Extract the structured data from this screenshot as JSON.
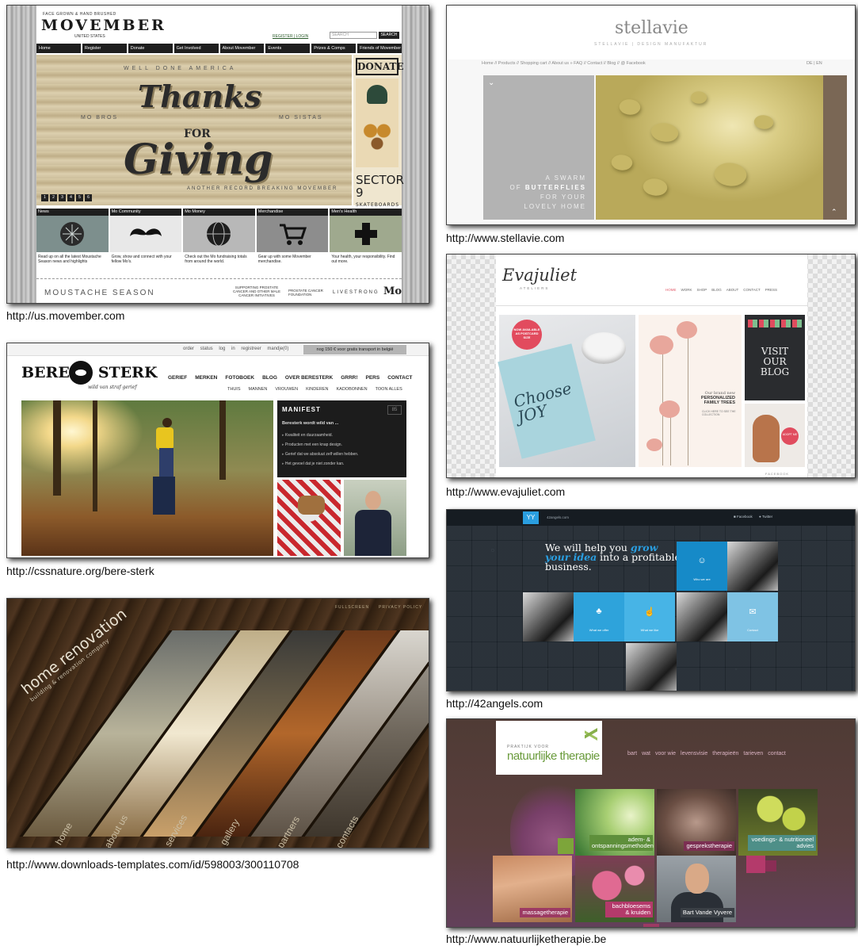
{
  "captions": {
    "movember": "http://us.movember.com",
    "beresterk": "http://cssnature.org/bere-sterk",
    "renovation": "http://www.downloads-templates.com/id/598003/300110708",
    "stellavie": "http://www.stellavie.com",
    "evajuliet": "http://www.evajuliet.com",
    "angels": "http://42angels.com",
    "therapie": "http://www.natuurlijketherapie.be"
  },
  "movember": {
    "tagline": "FACE GROWN & HAND BRUSHED",
    "logo": "MOVEMBER",
    "country": "UNITED STATES",
    "register_login": "REGISTER | LOGIN",
    "search_placeholder": "SEARCH",
    "search_button": "SEARCH",
    "nav": [
      "Home",
      "Register",
      "Donate",
      "Get Involved",
      "About Movember",
      "Events",
      "Prizes & Comps",
      "Friends of Movember"
    ],
    "hero": {
      "well_done": "WELL DONE AMERICA",
      "mo_bros": "MO BROS",
      "mo_sistas": "MO SISTAS",
      "thanks": "Thanks",
      "for": "FOR",
      "giving": "Giving",
      "another": "ANOTHER RECORD BREAKING MOVEMBER",
      "slides": [
        "1",
        "2",
        "3",
        "4",
        "5",
        "6"
      ]
    },
    "donate": "DONATE",
    "sector": "SECTOR 9",
    "sector_sub": "SKATEBOARDS",
    "tiles": [
      {
        "title": "News",
        "text": "Read up on all the latest Moustache Season news and highlights"
      },
      {
        "title": "Mo Community",
        "text": "Grow, show and connect with your fellow Mo's."
      },
      {
        "title": "Mo Money",
        "text": "Check out the Mo fundraising totals from around the world."
      },
      {
        "title": "Merchandise",
        "text": "Gear up with some Movember merchandise."
      },
      {
        "title": "Men's Health",
        "text": "Your health, your responsibility. Find out more."
      }
    ],
    "footer": {
      "season": "MOUSTACHE SEASON",
      "supporting": "SUPPORTING PROSTATE CANCER AND OTHER MALE CANCER INITIATIVES",
      "pcf": "PROSTATE CANCER FOUNDATION",
      "livestrong": "LIVESTRONG",
      "mo": "Mo"
    }
  },
  "beresterk": {
    "top_links": "order status   log in   registreer   mandje(0)",
    "promo": "nog 150 € voor gratis transport in belgië",
    "logo_left": "BERE",
    "logo_right": "STERK",
    "slogan": "wild van straf gerief",
    "menu": [
      "GERIEF",
      "MERKEN",
      "FOTOBOEK",
      "BLOG",
      "OVER BERESTERK",
      "GRRR!",
      "PERS",
      "CONTACT"
    ],
    "submenu": [
      "THUIS",
      "MANNEN",
      "VROUWEN",
      "KINDEREN",
      "KADOBONNEN",
      "TOON ALLES"
    ],
    "manifest": {
      "title": "MANIFEST",
      "number": "85",
      "intro": "Beresterk wordt wild van ...",
      "items": [
        "Kwaliteit en duurzaamheid.",
        "Producten met een knap design.",
        "Gerief dat we absoluut zelf willen hebben.",
        "Het gevoel dat je niet zonder kan."
      ]
    }
  },
  "renovation": {
    "brand": "home renovation",
    "brand_sub": "building & renovation company",
    "fullscreen": "FULLSCREEN",
    "privacy": "PRIVACY POLICY",
    "nav": [
      "home",
      "about us",
      "services",
      "gallery",
      "partners",
      "contacts"
    ]
  },
  "stellavie": {
    "logo": "stellavie",
    "tagline": "STELLAVIE | DESIGN MANUFAKTUR",
    "nav": "Home // Products // Shopping cart // About us » FAQ // Contact // Blog // @ Facebook",
    "lang": "DE | EN",
    "hero_text_1": "A SWARM",
    "hero_text_2": "OF",
    "hero_text_bold": "BUTTERFLIES",
    "hero_text_3": "FOR YOUR",
    "hero_text_4": "LOVELY HOME"
  },
  "evajuliet": {
    "logo": "Evajuliet",
    "sub": "ATELIERS",
    "nav": [
      "HOME",
      "WORK",
      "SHOP",
      "BLOG",
      "ABOUT",
      "CONTACT",
      "PRESS"
    ],
    "badge": "NOW AVAILABLE AS POSTCARD SIZE",
    "choose": "Choose JOY",
    "brand_new": "Our brand new",
    "personalized": "PERSONALIZED FAMILY TREES",
    "click": "CLICK HERE TO SEE THE COLLECTION",
    "visit": "VISIT OUR BLOG",
    "adopt": "ADOPT ME",
    "footer": "FACEBOOK   TWEET"
  },
  "angels": {
    "mark": "YY",
    "site": "42angels.com",
    "facebook": "Facebook",
    "twitter": "Twitter",
    "headline_1": "We will help you",
    "headline_grow": "grow",
    "headline_idea": "your idea",
    "headline_2": "into a profitable",
    "headline_3": "business.",
    "who": "Who we are",
    "offer": "What we offer",
    "like": "What we like",
    "contact": "Contact"
  },
  "therapie": {
    "praktijk": "PRAKTIJK VOOR",
    "name": "natuurlijke therapie",
    "menu": [
      "bart",
      "wat",
      "voor wie",
      "levensvisie",
      "therapieën",
      "tarieven",
      "contact"
    ],
    "tiles": [
      "adem- & ontspanningsmethoden",
      "gesprekstherapie",
      "voedings- & nutritioneel advies",
      "massagetherapie",
      "bachbloesems & kruiden",
      "Bart Vande Vyvere"
    ]
  }
}
